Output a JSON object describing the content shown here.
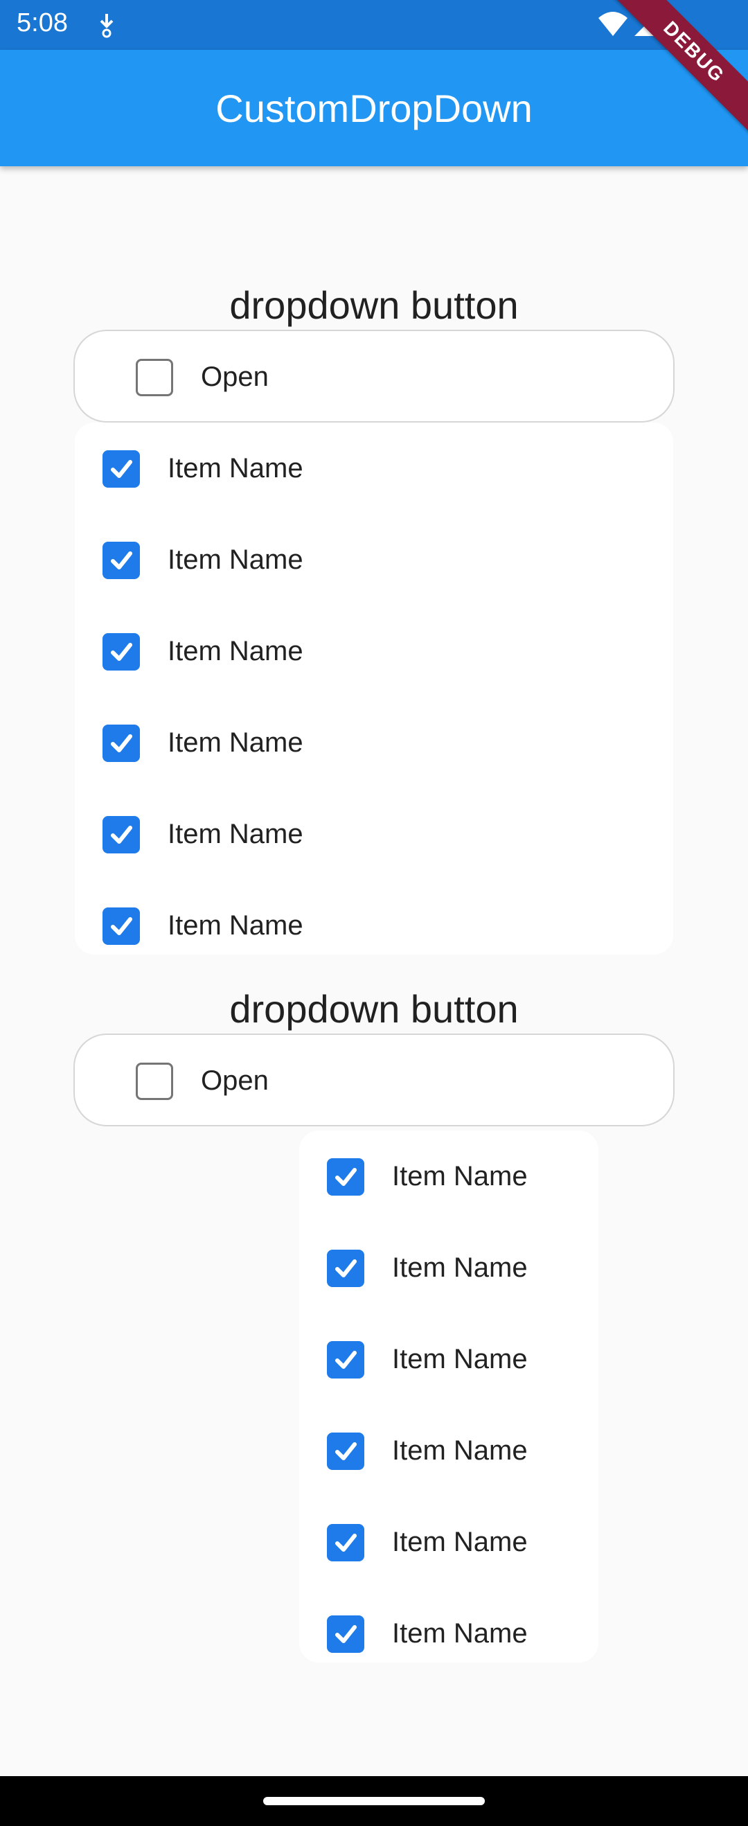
{
  "status_bar": {
    "time": "5:08"
  },
  "app_bar": {
    "title": "CustomDropDown"
  },
  "debug_banner": {
    "label": "DEBUG"
  },
  "sections": [
    {
      "title": "dropdown button",
      "open_label": "Open",
      "items": [
        "Item Name",
        "Item Name",
        "Item Name",
        "Item Name",
        "Item Name",
        "Item Name"
      ]
    },
    {
      "title": "dropdown button",
      "open_label": "Open",
      "items": [
        "Item Name",
        "Item Name",
        "Item Name",
        "Item Name",
        "Item Name",
        "Item Name"
      ]
    }
  ],
  "colors": {
    "status_bar": "#1976d2",
    "app_bar": "#2196f3",
    "checkbox_checked": "#1e7be9",
    "debug_banner": "#8b1a3a"
  }
}
